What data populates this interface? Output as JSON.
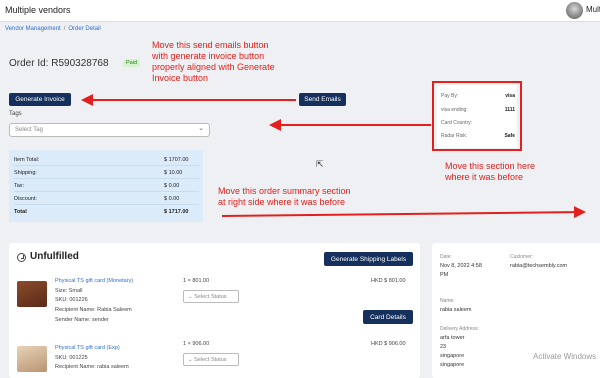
{
  "header": {
    "app_title": "Multiple vendors",
    "user_name": "Mult"
  },
  "breadcrumb": {
    "item1": "Vendor Management",
    "separator": "/",
    "item2": "Order Detail"
  },
  "order": {
    "id_label": "Order Id: R590328768",
    "status_badge": "Paid"
  },
  "buttons": {
    "generate_invoice": "Generate Invoice",
    "send_emails": "Send Emails",
    "generate_shipping_labels": "Generate Shipping Labels",
    "card_details": "Card Details"
  },
  "tags": {
    "label": "Tags",
    "placeholder": "Select Tag"
  },
  "summary": {
    "rows": [
      {
        "label": "Item Total:",
        "value": "$ 1707.00"
      },
      {
        "label": "Shipping:",
        "value": "$ 10.00"
      },
      {
        "label": "Tax:",
        "value": "$ 0.00"
      },
      {
        "label": "Discount:",
        "value": "$ 0.00"
      },
      {
        "label": "Total",
        "value": "$ 1717.00"
      }
    ]
  },
  "payment": {
    "rows": [
      {
        "label": "Pay By:",
        "value": "visa"
      },
      {
        "label": "visa ending:",
        "value": "1111"
      },
      {
        "label": "Card Country:",
        "value": ""
      },
      {
        "label": "Radar Risk:",
        "value": "Safe"
      }
    ]
  },
  "annotations": {
    "a1": [
      "Move this send emails button",
      "with generate invoice button",
      "properly aligned with Generate",
      "Invoice button"
    ],
    "a2": [
      "Move this section here",
      "where it was before"
    ],
    "a3": [
      "Move this order summary section",
      "at right side where it was before"
    ],
    "color": "#e3201b"
  },
  "unfulfilled": {
    "title": "Unfulfilled",
    "items": [
      {
        "name": "Physical TS gift card (Monetary)",
        "size": "Size: Small",
        "sku": "SKU: 001226",
        "recipient": "Recipient Name: Rabia Saleem",
        "sender": "Sender Name: sender",
        "qty": "1 × 801.00",
        "status_placeholder": "Select Status",
        "price": "HKD $ 801.00"
      },
      {
        "name": "Physical TS gift card (Exp)",
        "sku": "SKU: 001225",
        "recipient": "Recipient Name: rabia saleem",
        "qty": "1 × 906.00",
        "status_placeholder": "Select Status",
        "price": "HKD $ 906.00"
      }
    ]
  },
  "order_meta": {
    "date_label": "Date:",
    "date_value_1": "Nov 8, 2022 4:58",
    "date_value_2": "PM",
    "customer_label": "Customer:",
    "customer_value": "rabia@techsembly.com",
    "name_label": "Name:",
    "name_value": "rabia saleem",
    "address_label": "Delivery Address:",
    "address_lines": [
      "arfa tower",
      "23",
      "singapore",
      "singapore"
    ]
  },
  "watermark": "Activate Windows",
  "colors": {
    "primary_button": "#15305c",
    "link": "#2f6fd1",
    "summary_bg": "#dcebf9",
    "paid_badge_bg": "#d6f3d0"
  }
}
